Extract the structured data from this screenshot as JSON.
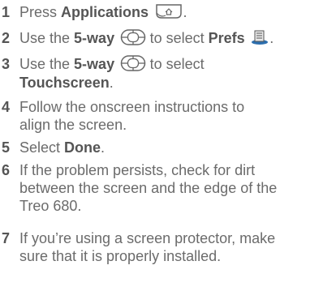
{
  "steps": [
    {
      "number": "1",
      "pre": "Press ",
      "bold": "Applications",
      "icon": "applications-icon",
      "post": "."
    },
    {
      "number": "2",
      "pre": "Use the ",
      "bold": "5-way",
      "icon": "five-way-navigator-icon",
      "mid": " to select ",
      "bold2": "Prefs",
      "icon2": "prefs-icon",
      "post": "."
    },
    {
      "number": "3",
      "pre": "Use the ",
      "bold": "5-way",
      "icon": "five-way-navigator-icon",
      "mid": " to select",
      "bold2": "Touchscreen",
      "post": "."
    },
    {
      "number": "4",
      "line1": "Follow the onscreen instructions to",
      "line2": "align the screen."
    },
    {
      "number": "5",
      "pre": "Select ",
      "bold": "Done",
      "post": "."
    },
    {
      "number": "6",
      "line1": "If the problem persists, check for dirt",
      "line2": "between the screen and the edge of the",
      "line3": "Treo 680."
    },
    {
      "number": "7",
      "line1": "If you’re using a screen protector, make",
      "line2": "sure that it is properly installed."
    }
  ]
}
